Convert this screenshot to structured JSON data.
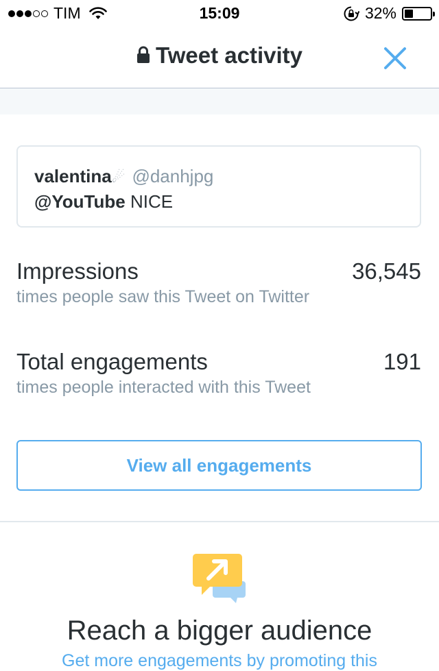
{
  "status_bar": {
    "carrier": "TIM",
    "time": "15:09",
    "battery": "32%",
    "battery_level": 0.32,
    "signal_bars": 3,
    "signal_total": 5
  },
  "nav": {
    "title": "Tweet activity",
    "title_icon": "lock-icon",
    "close_icon": "close-icon"
  },
  "tweet": {
    "name": "valentina",
    "name_emoji": "☄",
    "handle": "@danhjpg",
    "mention": "@YouTube",
    "text": "NICE"
  },
  "metrics": [
    {
      "label": "Impressions",
      "value": "36,545",
      "sub": "times people saw this Tweet on Twitter"
    },
    {
      "label": "Total engagements",
      "value": "191",
      "sub": "times people interacted with this Tweet"
    }
  ],
  "button": {
    "label": "View all engagements"
  },
  "promo": {
    "icon": "promote-chat-icon",
    "title": "Reach a bigger audience",
    "subtitle": "Get more engagements by promoting this"
  },
  "colors": {
    "accent": "#55acee",
    "text": "#292f33",
    "muted": "#8899a6",
    "band": "#f5f8fa",
    "promo_yellow": "#ffcc4d"
  }
}
